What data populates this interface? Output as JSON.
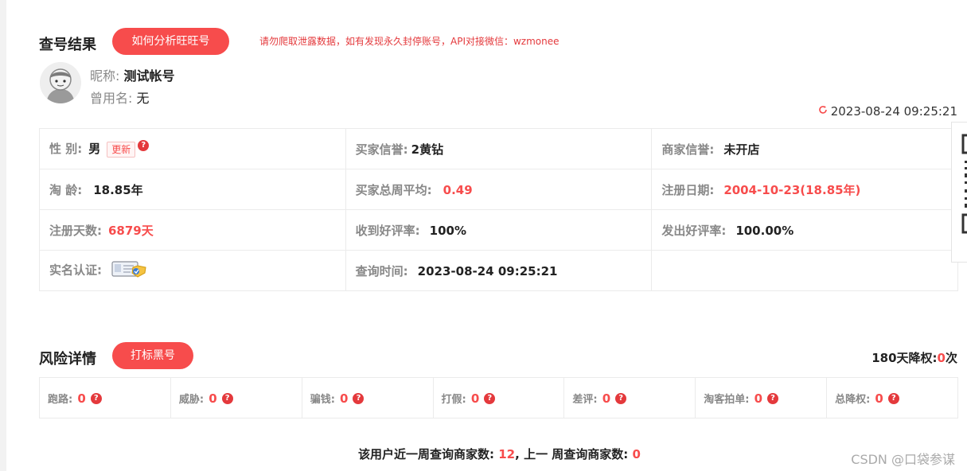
{
  "header": {
    "title": "查号结果",
    "analyze_button": "如何分析旺旺号",
    "notice": "请勿爬取泄露数据，如有发现永久封停账号，API对接微信：wzmonee"
  },
  "profile": {
    "nickname_label": "昵称:",
    "nickname": "测试帐号",
    "former_name_label": "曾用名:",
    "former_name": "无",
    "timestamp": "2023-08-24 09:25:21"
  },
  "info": {
    "gender_label": "性 别:",
    "gender": "男",
    "update_button": "更新",
    "buyer_credit_label": "买家信誉:",
    "buyer_credit": "2黄钻",
    "seller_credit_label": "商家信誉:",
    "seller_credit": "未开店",
    "age_label": "淘 龄:",
    "age": "18.85年",
    "buyer_weekly_label": "买家总周平均:",
    "buyer_weekly": "0.49",
    "reg_date_label": "注册日期:",
    "reg_date": "2004-10-23(18.85年)",
    "reg_days_label": "注册天数:",
    "reg_days": "6879天",
    "good_received_label": "收到好评率:",
    "good_received": "100%",
    "good_given_label": "发出好评率:",
    "good_given": "100.00%",
    "realname_label": "实名认证:",
    "query_time_label": "查询时间:",
    "query_time": "2023-08-24 09:25:21"
  },
  "risk": {
    "title": "风险详情",
    "mark_button": "打标黑号",
    "downgrade_label": "180天降权:",
    "downgrade_count": "0",
    "downgrade_unit": "次",
    "items": [
      {
        "label": "跑路:",
        "value": "0"
      },
      {
        "label": "威胁:",
        "value": "0"
      },
      {
        "label": "骗钱:",
        "value": "0"
      },
      {
        "label": "打假:",
        "value": "0"
      },
      {
        "label": "差评:",
        "value": "0"
      },
      {
        "label": "淘客拍单:",
        "value": "0"
      },
      {
        "label": "总降权:",
        "value": "0"
      }
    ]
  },
  "weekly": {
    "current_label": "该用户近一周查询商家数:",
    "current": "12",
    "sep": ",",
    "previous_label": "上一 周查询商家数:",
    "previous": "0"
  },
  "watermark": "CSDN @口袋参谋",
  "colors": {
    "accent": "#f74c4c",
    "notice": "#e4393c",
    "border": "#ebebeb"
  }
}
